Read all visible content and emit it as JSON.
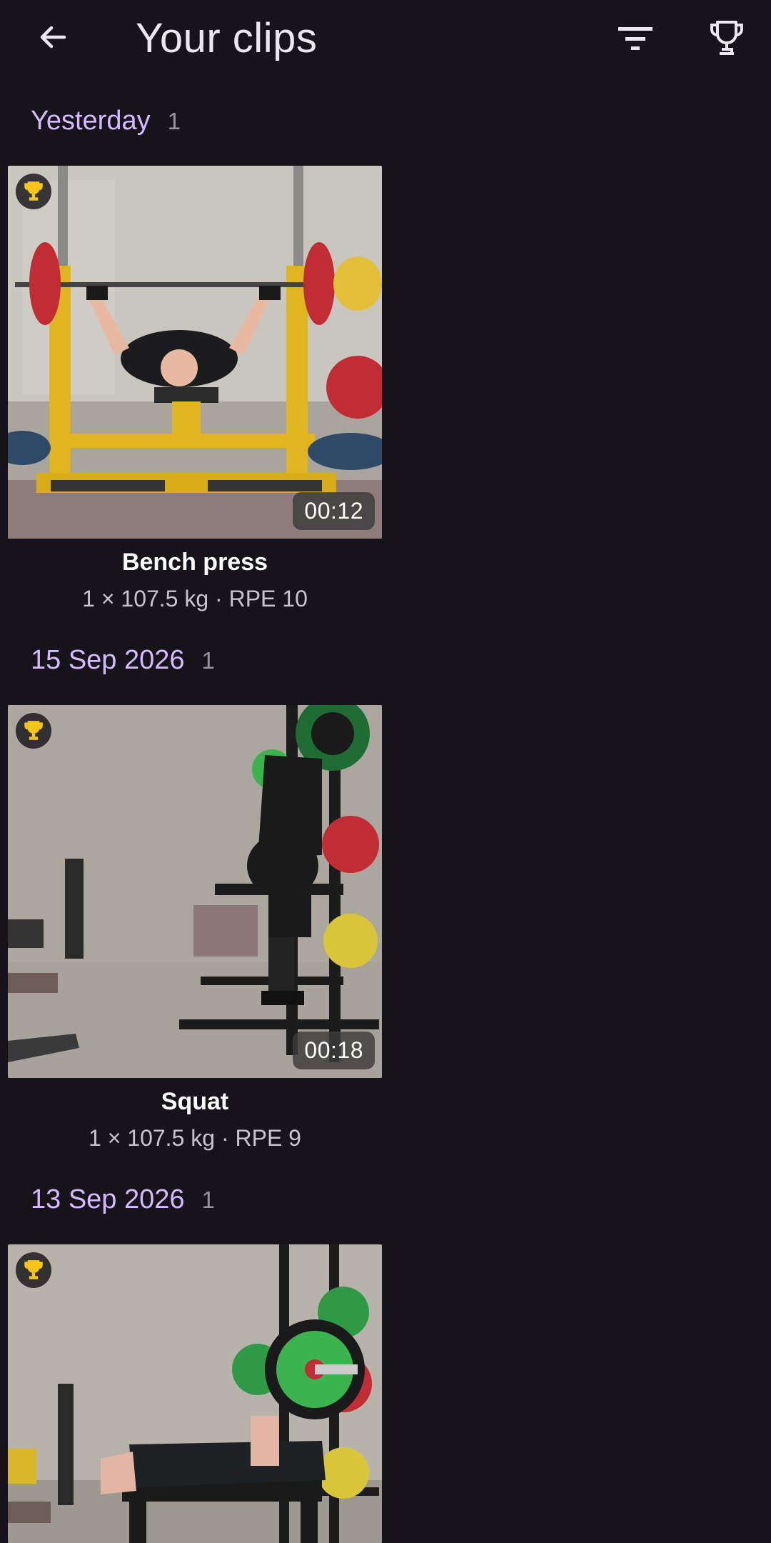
{
  "header": {
    "title": "Your clips",
    "icons": {
      "back": "arrow-back-icon",
      "filter": "filter-icon",
      "trophy": "trophy-icon"
    }
  },
  "sections": [
    {
      "label": "Yesterday",
      "count": "1",
      "clip": {
        "title": "Bench press",
        "subtitle": "1 × 107.5 kg · RPE 10",
        "duration": "00:12",
        "badge": "trophy-icon"
      }
    },
    {
      "label": "15 Sep 2026",
      "count": "1",
      "clip": {
        "title": "Squat",
        "subtitle": "1 × 107.5 kg · RPE 9",
        "duration": "00:18",
        "badge": "trophy-icon"
      }
    },
    {
      "label": "13 Sep 2026",
      "count": "1",
      "clip": {
        "badge": "trophy-icon"
      }
    }
  ],
  "colors": {
    "background": "#16131a",
    "accent": "#d4bbff",
    "trophy": "#f5c518"
  }
}
